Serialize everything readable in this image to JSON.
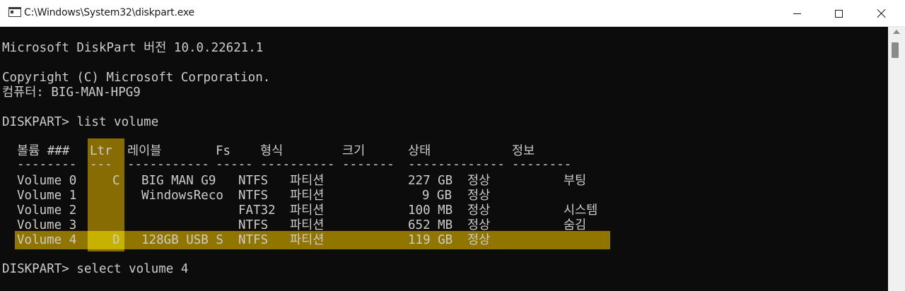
{
  "window": {
    "title": "C:\\Windows\\System32\\diskpart.exe",
    "icon": "console-icon",
    "controls": {
      "minimize": "minimize-icon",
      "maximize": "maximize-icon",
      "close": "close-icon"
    }
  },
  "console": {
    "version_line": "Microsoft DiskPart 버전 10.0.22621.1",
    "copyright_line": "Copyright (C) Microsoft Corporation.",
    "computer_line": "컴퓨터: BIG-MAN-HPG9",
    "command1": "DISKPART> list volume",
    "command2": "DISKPART> select volume 4",
    "table": {
      "headers": {
        "volume": "볼륨 ###",
        "ltr": "Ltr",
        "label": "레이블",
        "fs": "Fs",
        "type": "형식",
        "size": "크기",
        "status": "상태",
        "info": "정보"
      },
      "dashes": {
        "volume": "--------",
        "ltr": "---",
        "label": "-----------",
        "fs": "-----",
        "type": "----------",
        "size": "-------",
        "status": "-------------",
        "info": "--------"
      },
      "rows": [
        {
          "volume": "Volume 0",
          "ltr": "C",
          "label": "BIG MAN G9",
          "fs": "NTFS",
          "type": "파티션",
          "size": "227 GB",
          "status": "정상",
          "info": "부팅"
        },
        {
          "volume": "Volume 1",
          "ltr": "",
          "label": "WindowsReco",
          "fs": "NTFS",
          "type": "파티션",
          "size": "9 GB",
          "status": "정상",
          "info": ""
        },
        {
          "volume": "Volume 2",
          "ltr": "",
          "label": "",
          "fs": "FAT32",
          "type": "파티션",
          "size": "100 MB",
          "status": "정상",
          "info": "시스템"
        },
        {
          "volume": "Volume 3",
          "ltr": "",
          "label": "",
          "fs": "NTFS",
          "type": "파티션",
          "size": "652 MB",
          "status": "정상",
          "info": "숨김"
        },
        {
          "volume": "Volume 4",
          "ltr": "D",
          "label": "128GB USB S",
          "fs": "NTFS",
          "type": "파티션",
          "size": "119 GB",
          "status": "정상",
          "info": ""
        }
      ]
    }
  },
  "colors": {
    "console_bg": "#0c0c0c",
    "console_text": "#cccccc",
    "highlight": "#a98800",
    "highlight_cross": "#c8b200"
  }
}
